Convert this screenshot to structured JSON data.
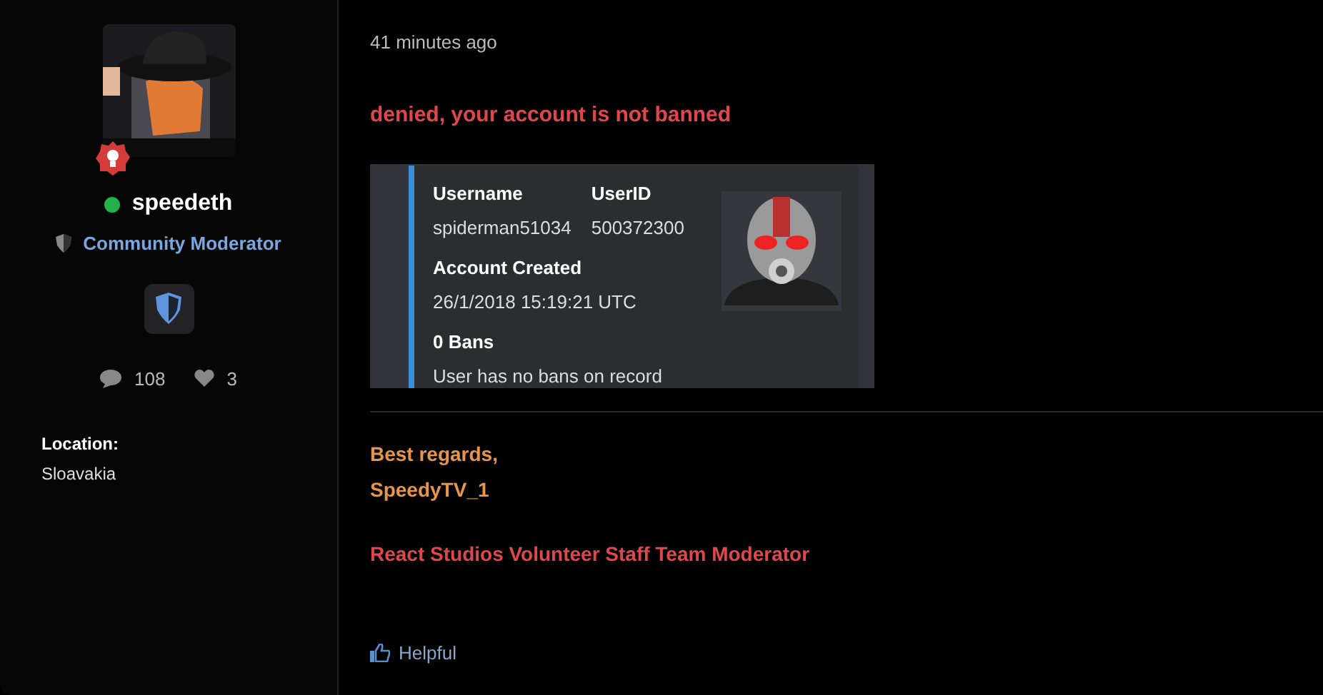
{
  "author": {
    "online": true,
    "name": "speedeth",
    "role": "Community Moderator",
    "stats": [
      {
        "kind": "messages",
        "value": "108"
      },
      {
        "kind": "likes",
        "value": "3"
      }
    ],
    "fields": [
      {
        "label": "Location:",
        "value": "Sloavakia"
      }
    ]
  },
  "post": {
    "time": "41 minutes ago",
    "headline": "denied, your account is not banned",
    "embed": {
      "fields": [
        {
          "name": "Username",
          "value": "spiderman51034"
        },
        {
          "name": "UserID",
          "value": "500372300"
        },
        {
          "name": "Account Created",
          "value": "26/1/2018 15:19:21 UTC"
        },
        {
          "name": "0 Bans",
          "value": "User has no bans on record"
        }
      ]
    },
    "signature": [
      {
        "kind": "regards",
        "text": "Best regards,"
      },
      {
        "kind": "regards",
        "text": "SpeedyTV_1"
      },
      {
        "kind": "title",
        "text": "React Studios Volunteer Staff Team Moderator"
      }
    ],
    "actions": [
      {
        "label": "Helpful"
      }
    ]
  }
}
